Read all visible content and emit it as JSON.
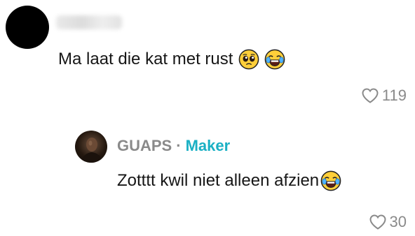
{
  "comment": {
    "text": "Ma laat die kat met rust",
    "emojis": [
      "pleading-face",
      "face-with-tears-of-joy"
    ],
    "like_count": "119"
  },
  "reply": {
    "author": "GUAPS",
    "separator": "·",
    "role_badge": "Maker",
    "text": "Zotttt kwil niet alleen afzien",
    "emojis": [
      "face-with-tears-of-joy"
    ],
    "like_count": "30"
  },
  "colors": {
    "text": "#161616",
    "muted": "#8a8a8a",
    "accent": "#1ab0c4"
  },
  "icons": {
    "like": "heart-outline-icon"
  }
}
